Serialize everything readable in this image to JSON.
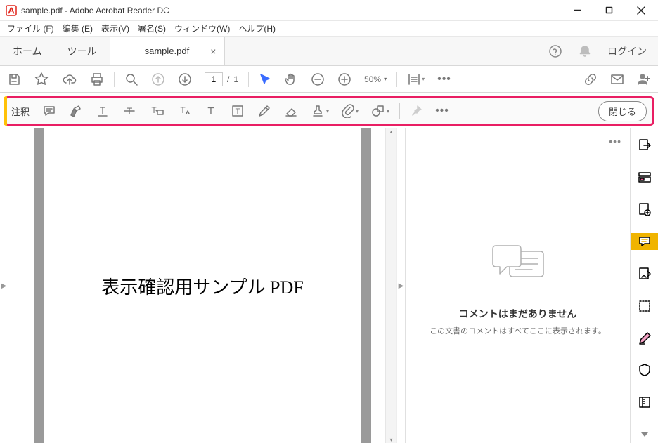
{
  "window": {
    "title": "sample.pdf - Adobe Acrobat Reader DC"
  },
  "menu": [
    "ファイル (F)",
    "編集 (E)",
    "表示(V)",
    "署名(S)",
    "ウィンドウ(W)",
    "ヘルプ(H)"
  ],
  "tabbar": {
    "home": "ホーム",
    "tools": "ツール",
    "doc": "sample.pdf",
    "login": "ログイン"
  },
  "maintb": {
    "page_current": "1",
    "page_sep": "/",
    "page_total": "1",
    "zoom": "50%"
  },
  "annot": {
    "label": "注釈",
    "close": "閉じる"
  },
  "document": {
    "content": "表示確認用サンプル PDF"
  },
  "comments": {
    "title": "コメントはまだありません",
    "sub": "この文書のコメントはすべてここに表示されます。"
  }
}
